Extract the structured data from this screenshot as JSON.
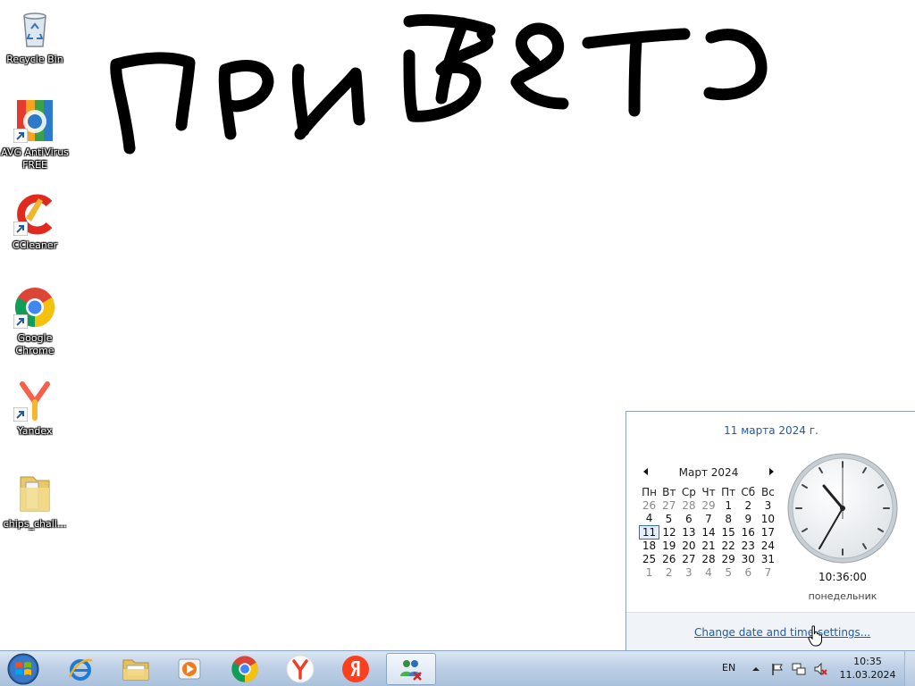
{
  "desktop": {
    "icons": [
      {
        "label": "Recycle Bin",
        "icon": "recycle-bin-icon"
      },
      {
        "label": "AVG AntiVirus FREE",
        "icon": "avg-antivirus-icon"
      },
      {
        "label": "CCleaner",
        "icon": "ccleaner-icon"
      },
      {
        "label": "Google Chrome",
        "icon": "chrome-icon"
      },
      {
        "label": "Yandex",
        "icon": "yandex-browser-icon"
      },
      {
        "label": "chips_chall...",
        "icon": "folder-icon"
      }
    ],
    "handwriting": "привет"
  },
  "calendar_flyout": {
    "long_date": "11 марта 2024 г.",
    "month_label": "Март 2024",
    "weekdays": [
      "Пн",
      "Вт",
      "Ср",
      "Чт",
      "Пт",
      "Сб",
      "Вс"
    ],
    "weeks": [
      [
        "26",
        "27",
        "28",
        "29",
        "1",
        "2",
        "3"
      ],
      [
        "4",
        "5",
        "6",
        "7",
        "8",
        "9",
        "10"
      ],
      [
        "11",
        "12",
        "13",
        "14",
        "15",
        "16",
        "17"
      ],
      [
        "18",
        "19",
        "20",
        "21",
        "22",
        "23",
        "24"
      ],
      [
        "25",
        "26",
        "27",
        "28",
        "29",
        "30",
        "31"
      ],
      [
        "1",
        "2",
        "3",
        "4",
        "5",
        "6",
        "7"
      ]
    ],
    "today": "11",
    "clock_time": "10:36:00",
    "weekday_name": "понедельник",
    "settings_link": "Change date and time settings..."
  },
  "taskbar": {
    "start_icon": "windows-start-orb-icon",
    "pinned": [
      {
        "icon": "internet-explorer-icon"
      },
      {
        "icon": "file-explorer-icon"
      },
      {
        "icon": "media-player-icon"
      },
      {
        "icon": "chrome-icon"
      },
      {
        "icon": "yandex-browser-icon"
      },
      {
        "icon": "yandex-icon"
      },
      {
        "icon": "network-users-icon",
        "active": true
      }
    ],
    "tray": {
      "language": "EN",
      "time": "10:35",
      "date": "11.03.2024"
    }
  },
  "colors": {
    "link": "#1e5aa8",
    "taskbar": "#bed0e6",
    "today_border": "#3a6ea5"
  }
}
